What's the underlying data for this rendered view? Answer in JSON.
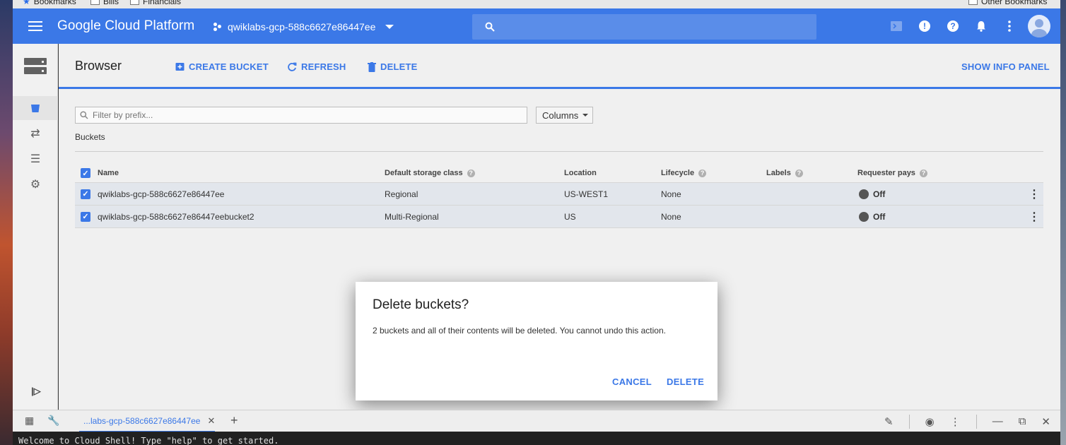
{
  "bookmarks_bar": {
    "items": [
      "Bookmarks",
      "Bills",
      "Financials"
    ],
    "other": "Other Bookmarks"
  },
  "topbar": {
    "brand": "Google Cloud Platform",
    "project": "qwiklabs-gcp-588c6627e86447ee",
    "search_placeholder": ""
  },
  "toolbar": {
    "title": "Browser",
    "create_bucket": "CREATE BUCKET",
    "refresh": "REFRESH",
    "delete": "DELETE",
    "show_info_panel": "SHOW INFO PANEL"
  },
  "filter": {
    "placeholder": "Filter by prefix...",
    "columns_label": "Columns"
  },
  "section_label": "Buckets",
  "table": {
    "headers": {
      "name": "Name",
      "storage_class": "Default storage class",
      "location": "Location",
      "lifecycle": "Lifecycle",
      "labels": "Labels",
      "requester_pays": "Requester pays"
    },
    "rows": [
      {
        "name": "qwiklabs-gcp-588c6627e86447ee",
        "storage_class": "Regional",
        "location": "US-WEST1",
        "lifecycle": "None",
        "labels": "",
        "requester_pays": "Off"
      },
      {
        "name": "qwiklabs-gcp-588c6627e86447eebucket2",
        "storage_class": "Multi-Regional",
        "location": "US",
        "lifecycle": "None",
        "labels": "",
        "requester_pays": "Off"
      }
    ]
  },
  "dialog": {
    "title": "Delete buckets?",
    "body": "2 buckets and all of their contents will be deleted. You cannot undo this action.",
    "cancel": "CANCEL",
    "delete": "DELETE"
  },
  "cloud_shell": {
    "tab_label": "...labs-gcp-588c6627e86447ee",
    "terminal_text": "Welcome to Cloud Shell! Type \"help\" to get started."
  },
  "colors": {
    "accent": "#3b78e7",
    "row_selected": "#e2e6ec"
  }
}
